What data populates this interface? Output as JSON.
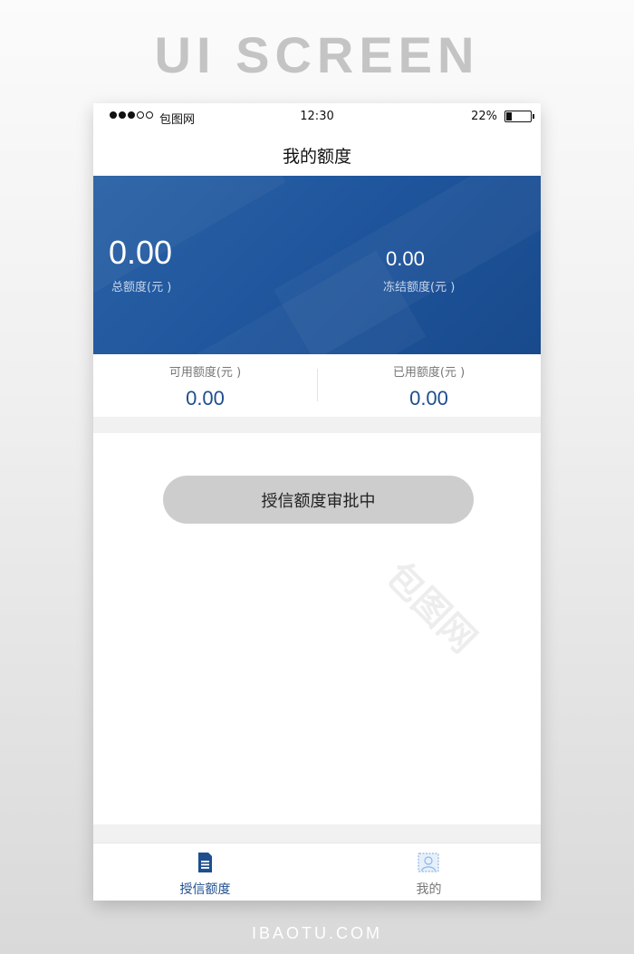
{
  "page_heading": "UI SCREEN",
  "page_footer": "IBAOTU.COM",
  "status_bar": {
    "carrier": "包图网",
    "time": "12:30",
    "battery_percent": "22%",
    "battery_level": 0.22
  },
  "nav": {
    "title": "我的额度"
  },
  "quota_card": {
    "total_value": "0.00",
    "total_label": "总额度(元 )",
    "frozen_value": "0.00",
    "frozen_label": "冻结额度(元 )",
    "background_color": "#1f559c"
  },
  "stats": {
    "available_label": "可用额度(元 )",
    "available_value": "0.00",
    "used_label": "已用额度(元 )",
    "used_value": "0.00"
  },
  "pending_button": {
    "label": "授信额度审批中"
  },
  "tab_bar": {
    "tabs": [
      {
        "label": "授信额度",
        "icon": "document-icon",
        "active": true
      },
      {
        "label": "我的",
        "icon": "profile-icon",
        "active": false
      }
    ],
    "active_color": "#1d4e8e"
  },
  "watermark": {
    "text": "包图网"
  }
}
